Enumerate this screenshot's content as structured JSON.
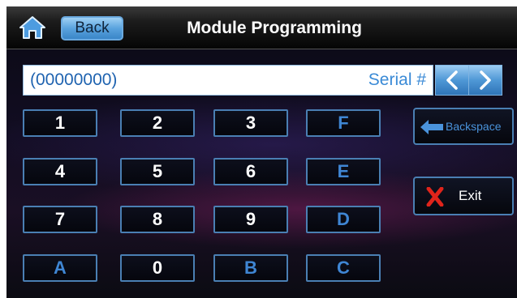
{
  "header": {
    "home_icon": "home-icon",
    "back_label": "Back",
    "title": "Module Programming"
  },
  "display": {
    "value": "(00000000)",
    "field_label": "Serial #",
    "prev_icon": "chevron-left-icon",
    "next_icon": "chevron-right-icon"
  },
  "keypad": {
    "keys": [
      "1",
      "2",
      "3",
      "F",
      "4",
      "5",
      "6",
      "E",
      "7",
      "8",
      "9",
      "D",
      "A",
      "0",
      "B",
      "C"
    ]
  },
  "side": {
    "backspace_label": "Backspace",
    "backspace_icon": "arrow-left-icon",
    "exit_label": "Exit",
    "exit_icon": "close-x-icon"
  },
  "colors": {
    "accent_blue": "#3f86d4",
    "exit_red": "#e0241b",
    "key_border": "#4a7fb3"
  }
}
